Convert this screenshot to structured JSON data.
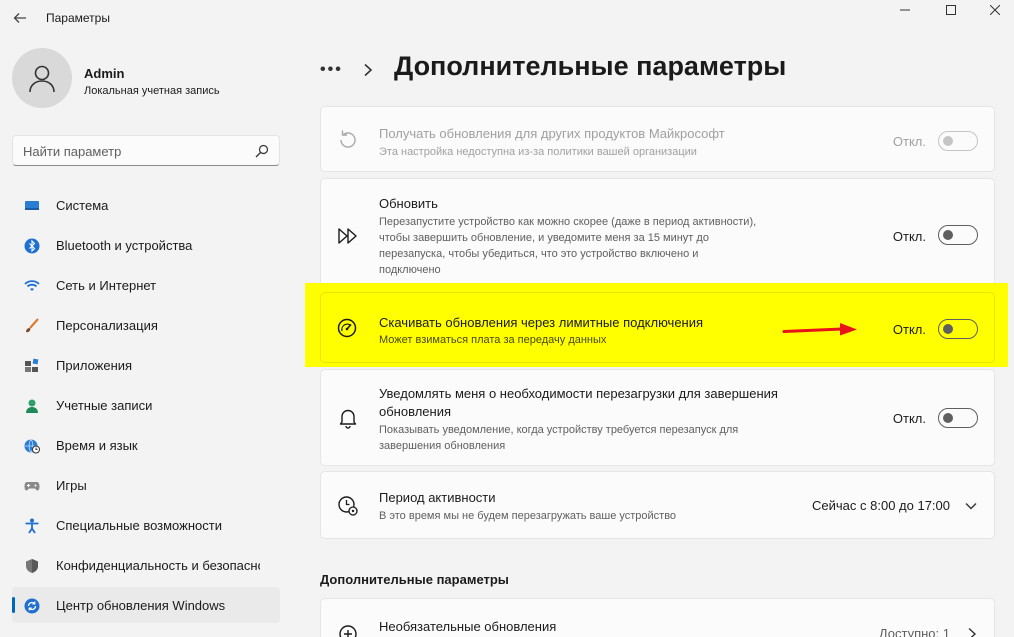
{
  "app": {
    "title": "Параметры"
  },
  "user": {
    "name": "Admin",
    "account_type": "Локальная учетная запись"
  },
  "search": {
    "placeholder": "Найти параметр"
  },
  "sidebar": {
    "items": [
      {
        "label": "Система",
        "icon": "system-icon",
        "active": false
      },
      {
        "label": "Bluetooth и устройства",
        "icon": "bluetooth-icon",
        "active": false
      },
      {
        "label": "Сеть и Интернет",
        "icon": "wifi-icon",
        "active": false
      },
      {
        "label": "Персонализация",
        "icon": "brush-icon",
        "active": false
      },
      {
        "label": "Приложения",
        "icon": "apps-icon",
        "active": false
      },
      {
        "label": "Учетные записи",
        "icon": "account-icon",
        "active": false
      },
      {
        "label": "Время и язык",
        "icon": "globe-clock-icon",
        "active": false
      },
      {
        "label": "Игры",
        "icon": "gamepad-icon",
        "active": false
      },
      {
        "label": "Специальные возможности",
        "icon": "accessibility-icon",
        "active": false
      },
      {
        "label": "Конфиденциальность и безопасность",
        "icon": "shield-icon",
        "active": false
      },
      {
        "label": "Центр обновления Windows",
        "icon": "update-icon",
        "active": true
      }
    ]
  },
  "breadcrumb": {
    "dots": "•••",
    "title": "Дополнительные параметры"
  },
  "settings": {
    "other_products": {
      "title": "Получать обновления для других продуктов Майкрософт",
      "desc": "Эта настройка недоступна из-за политики вашей организации",
      "state": "Откл."
    },
    "restart_asap": {
      "title": "Обновить",
      "desc_lines": [
        "Перезапустите устройство как можно скорее (даже в период активности),",
        "чтобы завершить обновление, и уведомите меня за 15 минут до",
        "перезапуска, чтобы убедиться, что это устройство включено и",
        "подключено"
      ],
      "state": "Откл."
    },
    "metered": {
      "title": "Скачивать обновления через лимитные подключения",
      "desc": "Может взиматься плата за передачу данных",
      "state": "Откл."
    },
    "notify_restart": {
      "title_lines": [
        "Уведомлять меня о необходимости перезагрузки для завершения",
        "обновления"
      ],
      "desc_lines": [
        "Показывать уведомление, когда устройству требуется перезапуск для",
        "завершения обновления"
      ],
      "state": "Откл."
    },
    "active_hours": {
      "title": "Период активности",
      "desc": "В это время мы не будем перезагружать ваше устройство",
      "value": "Сейчас с 8:00 до 17:00"
    }
  },
  "additional": {
    "section_title": "Дополнительные параметры",
    "optional_updates": {
      "title": "Необязательные обновления",
      "count": "Доступно: 1"
    }
  },
  "colors": {
    "accent": "#0067c0",
    "highlight": "#ffff00",
    "arrow": "#e8141a"
  }
}
